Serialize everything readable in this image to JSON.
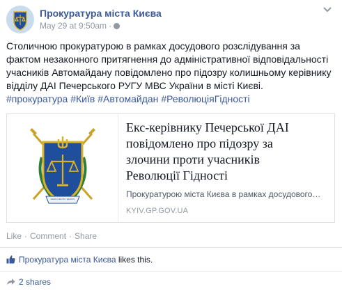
{
  "post": {
    "page_name": "Прокуратура міста Києва",
    "timestamp": "May 29 at 9:50am",
    "meta_separator": "·",
    "text_lines": [
      "Столичною прокуратурою в рамках досудового розслідування за",
      "фактом незаконного притягнення до адміністративної відповідальності",
      "учасників Автомайдану повідомлено про підозру колишньому керівнику",
      "відділу ДАІ Печерського РУГУ МВС України в місті Києві."
    ],
    "hashtags": [
      "#прокуратура",
      "#Київ",
      "#Автомайдан",
      "#РеволюціяГідності"
    ]
  },
  "share_card": {
    "title_lines": [
      "Екс-керівнику Печерської ДАІ",
      "повідомлено про підозру за",
      "злочини проти учасників",
      "Революції Гідності"
    ],
    "description": "Прокуратурою міста Києва в рамках досудового…",
    "domain": "KYIV.GP.GOV.UA",
    "emblem_ribbon_text": "ЗАКОН ЧЕСТЬ ГІДНІСТЬ"
  },
  "actions": {
    "like": "Like",
    "comment": "Comment",
    "share": "Share",
    "separator": "·"
  },
  "likes": {
    "liker": "Прокуратура міста Києва",
    "suffix": " likes this."
  },
  "shares": {
    "label": "2 shares"
  },
  "icons": {
    "avatar": "prosecutor-emblem-icon",
    "visibility": "globe-icon",
    "menu": "chevron-down-icon",
    "likes": "thumbs-up-icon",
    "shares": "share-arrow-icon"
  },
  "colors": {
    "link": "#3b5998",
    "meta": "#9197a3",
    "text": "#141823",
    "emblem_blue": "#1f4e9c",
    "emblem_gold": "#d9b227"
  }
}
